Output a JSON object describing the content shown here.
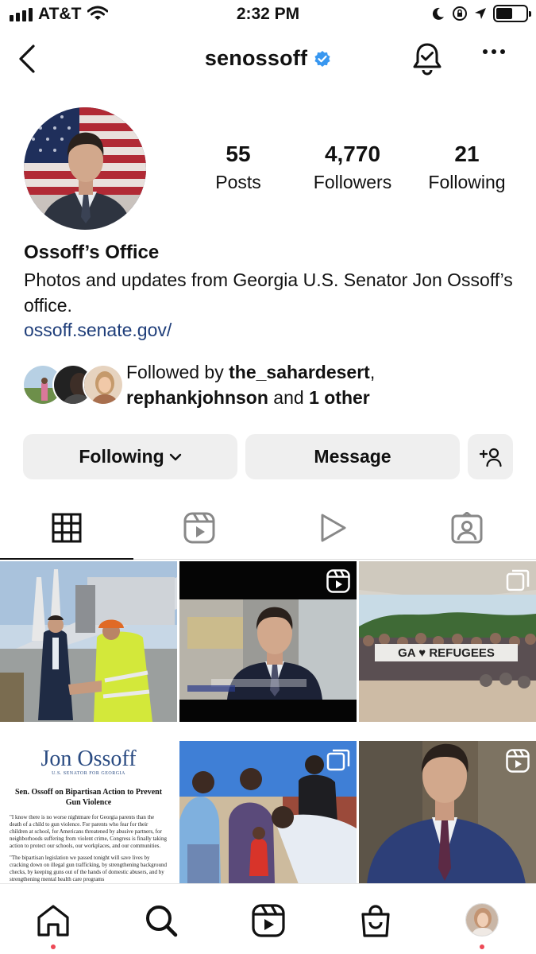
{
  "status_bar": {
    "carrier": "AT&T",
    "time": "2:32 PM",
    "battery_level": 0.55
  },
  "header": {
    "username": "senossoff",
    "verified": true,
    "icons": [
      "back-icon",
      "verified-badge-icon",
      "notification-bell-icon",
      "more-options-icon"
    ]
  },
  "profile": {
    "stats": [
      {
        "value": "55",
        "label": "Posts"
      },
      {
        "value": "4,770",
        "label": "Followers"
      },
      {
        "value": "21",
        "label": "Following"
      }
    ],
    "name": "Ossoff’s Office",
    "bio": "Photos and updates from Georgia U.S. Senator Jon Ossoff’s office.",
    "link": "ossoff.senate.gov/"
  },
  "followed_by": {
    "prefix": "Followed by ",
    "user1": "the_sahardesert",
    "sep": ",",
    "user2": "rephankjohnson",
    "and": " and ",
    "other": "1 other"
  },
  "actions": {
    "following_label": "Following",
    "message_label": "Message"
  },
  "tabs": [
    {
      "name": "grid",
      "icon": "grid-icon",
      "active": true
    },
    {
      "name": "reels",
      "icon": "reels-icon",
      "active": false
    },
    {
      "name": "videos",
      "icon": "play-icon",
      "active": false
    },
    {
      "name": "tagged",
      "icon": "tagged-icon",
      "active": false
    }
  ],
  "posts": {
    "post3_sign": "GA ♥ REFUGEES",
    "post4": {
      "logo": "Jon Ossoff",
      "subtitle": "U.S. SENATOR FOR GEORGIA",
      "headline": "Sen. Ossoff on Bipartisan Action to Prevent Gun Violence",
      "paragraph1": "\"I know there is no worse nightmare for Georgia parents than the death of a child to gun violence. For parents who fear for their children at school, for Americans threatened by abusive partners, for neighborhoods suffering from violent crime, Congress is finally taking action to protect our schools, our workplaces, and our communities.",
      "paragraph2": "\"The bipartisan legislation we passed tonight will save lives by cracking down on illegal gun trafficking, by strengthening background checks, by keeping guns out of the hands of domestic abusers, and by strengthening mental health care programs"
    }
  },
  "bottom_nav": [
    "home-icon",
    "search-icon",
    "reels-icon",
    "shop-icon",
    "profile-avatar"
  ],
  "colors": {
    "link": "#1f3e7a",
    "verified": "#3897f0",
    "notification_dot": "#ed4956",
    "button_bg": "#efefef"
  }
}
